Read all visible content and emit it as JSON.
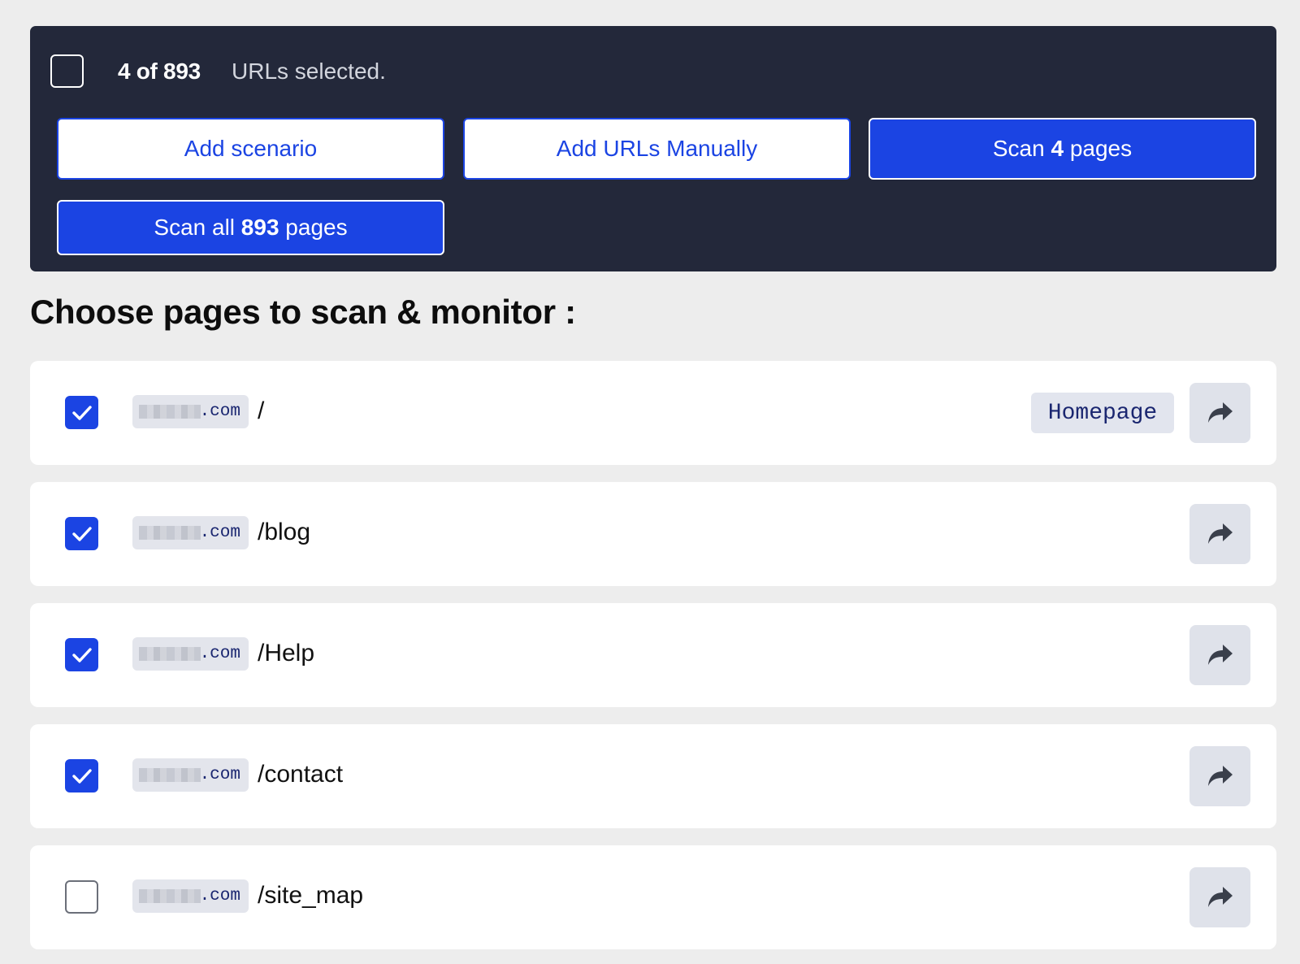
{
  "selection": {
    "count": "4 of 893",
    "suffix": "URLs selected."
  },
  "buttons": {
    "add_scenario": "Add scenario",
    "add_urls_manually": "Add URLs Manually",
    "scan_selected_prefix": "Scan ",
    "scan_selected_count": "4",
    "scan_selected_suffix": " pages",
    "scan_all_prefix": "Scan all ",
    "scan_all_count": "893",
    "scan_all_suffix": " pages"
  },
  "heading": "Choose pages to scan & monitor :",
  "rows": [
    {
      "checked": true,
      "domain": ".com",
      "path": "/",
      "tag": "Homepage"
    },
    {
      "checked": true,
      "domain": ".com",
      "path": "/blog"
    },
    {
      "checked": true,
      "domain": ".com",
      "path": "/Help"
    },
    {
      "checked": true,
      "domain": ".com",
      "path": "/contact"
    },
    {
      "checked": false,
      "domain": ".com",
      "path": "/site_map"
    }
  ],
  "colors": {
    "panel_bg": "#23283a",
    "accent": "#1b44e3",
    "page_bg": "#ededed"
  },
  "icons": {
    "row_action": "share-arrow-icon",
    "checkbox_mark": "checkmark-icon"
  }
}
